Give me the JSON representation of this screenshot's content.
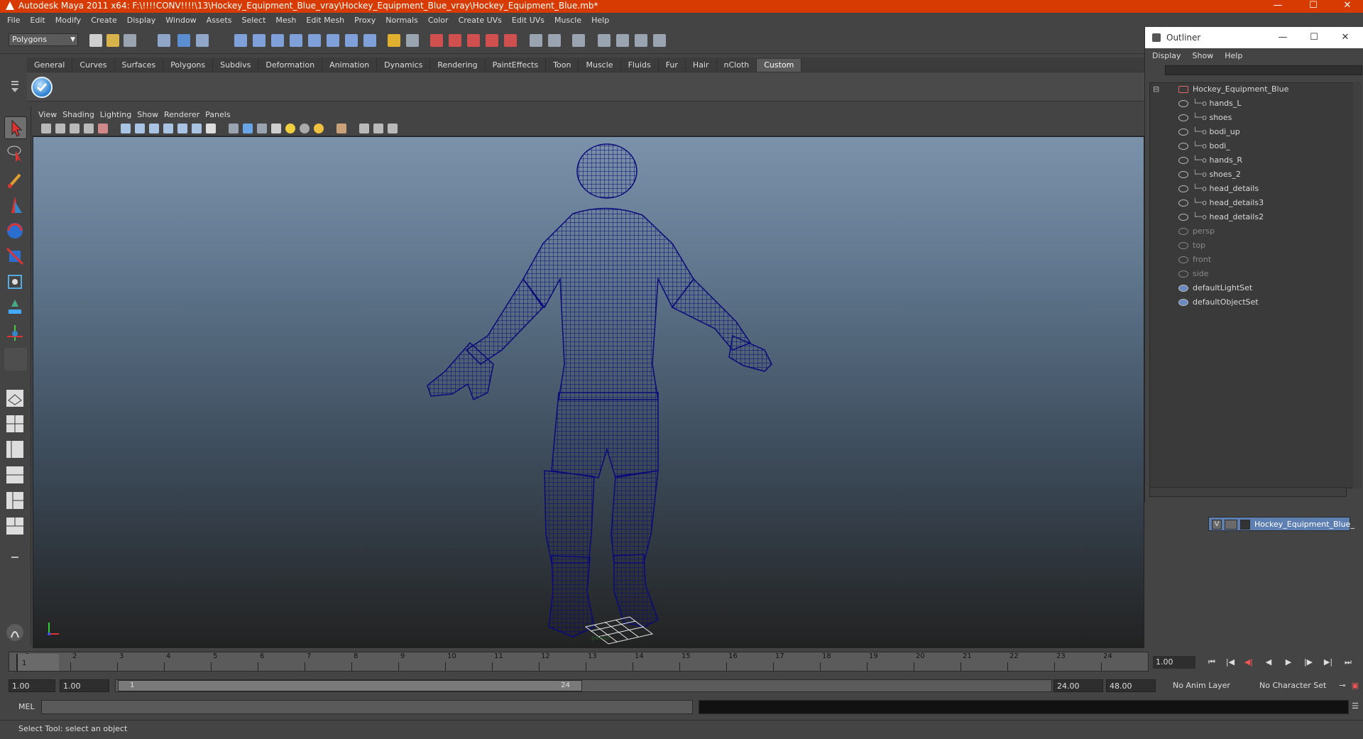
{
  "window": {
    "title": "Autodesk Maya 2011 x64: F:\\!!!!CONV!!!!\\13\\Hockey_Equipment_Blue_vray\\Hockey_Equipment_Blue_vray\\Hockey_Equipment_Blue.mb*",
    "minimize": "—",
    "maximize": "☐",
    "close": "✕"
  },
  "menubar": [
    "File",
    "Edit",
    "Modify",
    "Create",
    "Display",
    "Window",
    "Assets",
    "Select",
    "Mesh",
    "Edit Mesh",
    "Proxy",
    "Normals",
    "Color",
    "Create UVs",
    "Edit UVs",
    "Muscle",
    "Help"
  ],
  "statusline": {
    "mode": "Polygons"
  },
  "shelf": {
    "tabs": [
      "General",
      "Curves",
      "Surfaces",
      "Polygons",
      "Subdivs",
      "Deformation",
      "Animation",
      "Dynamics",
      "Rendering",
      "PaintEffects",
      "Toon",
      "Muscle",
      "Fluids",
      "Fur",
      "Hair",
      "nCloth",
      "Custom"
    ],
    "active": "Custom"
  },
  "panel": {
    "menu": [
      "View",
      "Shading",
      "Lighting",
      "Show",
      "Renderer",
      "Panels"
    ],
    "camera_label": "persp"
  },
  "outliner": {
    "title": "Outliner",
    "menu": [
      "Display",
      "Show",
      "Help"
    ],
    "items": [
      {
        "label": "Hockey_Equipment_Blue",
        "indent": 0,
        "dim": false
      },
      {
        "label": "hands_L",
        "indent": 1,
        "dim": false
      },
      {
        "label": "shoes",
        "indent": 1,
        "dim": false
      },
      {
        "label": "bodi_up",
        "indent": 1,
        "dim": false
      },
      {
        "label": "bodi_",
        "indent": 1,
        "dim": false
      },
      {
        "label": "hands_R",
        "indent": 1,
        "dim": false
      },
      {
        "label": "shoes_2",
        "indent": 1,
        "dim": false
      },
      {
        "label": "head_details",
        "indent": 1,
        "dim": false
      },
      {
        "label": "head_details3",
        "indent": 1,
        "dim": false
      },
      {
        "label": "head_details2",
        "indent": 1,
        "dim": false
      },
      {
        "label": "persp",
        "indent": 0,
        "dim": true
      },
      {
        "label": "top",
        "indent": 0,
        "dim": true
      },
      {
        "label": "front",
        "indent": 0,
        "dim": true
      },
      {
        "label": "side",
        "indent": 0,
        "dim": true
      },
      {
        "label": "defaultLightSet",
        "indent": 0,
        "dim": false
      },
      {
        "label": "defaultObjectSet",
        "indent": 0,
        "dim": false
      }
    ]
  },
  "layers": {
    "visible_flag": "V",
    "layer_name": "Hockey_Equipment_Blue_"
  },
  "timeslider": {
    "ticks": [
      "1",
      "2",
      "3",
      "4",
      "5",
      "6",
      "7",
      "8",
      "9",
      "10",
      "11",
      "12",
      "13",
      "14",
      "15",
      "16",
      "17",
      "18",
      "19",
      "20",
      "21",
      "22",
      "23",
      "24"
    ],
    "current": "1",
    "current_field": "1.00"
  },
  "range": {
    "start": "1.00",
    "start2": "1.00",
    "handle_start": "1",
    "handle_end": "24",
    "end": "24.00",
    "end2": "48.00",
    "anim_layer": "No Anim Layer",
    "char_set": "No Character Set"
  },
  "cmd": {
    "label": "MEL"
  },
  "help": {
    "text": "Select Tool: select an object"
  },
  "colors": {
    "titlebar": "#d83b01",
    "mesh": "#0a0a78",
    "layer": "#5d7fb1"
  }
}
